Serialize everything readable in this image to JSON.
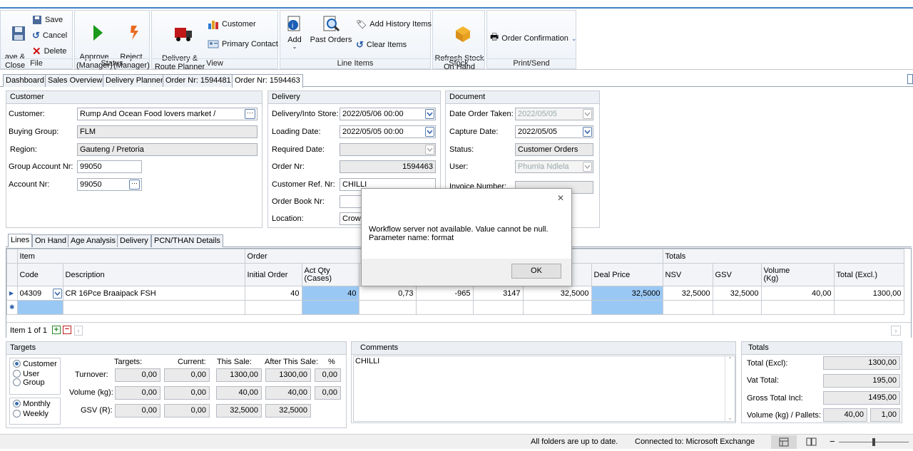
{
  "ribbon": {
    "file": {
      "title": "File",
      "save_close": "ave &\nClose",
      "save": "Save",
      "cancel": "Cancel",
      "delete": "Delete"
    },
    "status": {
      "title": "Status",
      "approve": "Approve\n(Manager)",
      "reject": "Reject\n(Manager)"
    },
    "view": {
      "title": "View",
      "delivery_planner": "Delivery &\nRoute Planner",
      "customer": "Customer",
      "primary_contact": "Primary Contact"
    },
    "line_items": {
      "title": "Line Items",
      "add": "Add",
      "past_orders": "Past Orders",
      "add_history": "Add History Items",
      "clear_items": "Clear Items"
    },
    "stock": {
      "title": "Stock",
      "refresh": "Refresh Stock\nOn Hand"
    },
    "print": {
      "title": "Print/Send",
      "order_confirmation": "Order Confirmation"
    }
  },
  "tabs": [
    "Dashboard",
    "Sales Overview",
    "Delivery Planner",
    "Order Nr: 1594481",
    "Order Nr: 1594463"
  ],
  "customer": {
    "title": "Customer",
    "customer_label": "Customer:",
    "customer_value": "Rump And Ocean Food lovers market /",
    "group_label": "Buying Group:",
    "group_value": "FLM",
    "region_label": "Region:",
    "region_value": "Gauteng / Pretoria",
    "group_acc_label": "Group Account Nr:",
    "group_acc_value": "99050",
    "acc_label": "Account Nr:",
    "acc_value": "99050"
  },
  "delivery": {
    "title": "Delivery",
    "into_store_label": "Delivery/Into Store:",
    "into_store_value": "2022/05/06 00:00",
    "loading_label": "Loading Date:",
    "loading_value": "2022/05/05 00:00",
    "required_label": "Required Date:",
    "required_value": "",
    "order_nr_label": "Order Nr:",
    "order_nr_value": "1594463",
    "cust_ref_label": "Customer Ref. Nr:",
    "cust_ref_value": "CHILLI",
    "order_book_label": "Order Book Nr:",
    "order_book_value": "",
    "location_label": "Location:",
    "location_value": "Crown"
  },
  "document": {
    "title": "Document",
    "date_taken_label": "Date Order Taken:",
    "date_taken_value": "2022/05/05",
    "capture_label": "Capture Date:",
    "capture_value": "2022/05/05",
    "status_label": "Status:",
    "status_value": "Customer Orders",
    "user_label": "User:",
    "user_value": "Phumla Ndlela",
    "invoice_label": "Invoice Number:"
  },
  "lower_tabs": [
    "Lines",
    "On Hand",
    "Age Analysis",
    "Delivery",
    "PCN/THAN Details"
  ],
  "grid": {
    "group_item": "Item",
    "group_order": "Order",
    "group_totals": "Totals",
    "headers": [
      "Code",
      "Description",
      "Initial Order",
      "Act Qty\n(Cases)",
      "",
      "",
      "",
      "Price",
      "Deal Price",
      "NSV",
      "GSV",
      "Volume\n(Kg)",
      "Total (Excl.)"
    ],
    "row": [
      "04309",
      "CR 16Pce Braaipack FSH",
      "40",
      "40",
      "0,73",
      "-965",
      "3147",
      "32,5000",
      "32,5000",
      "32,5000",
      "32,5000",
      "40,00",
      "1300,00"
    ],
    "footer": "Item 1 of 1"
  },
  "targets": {
    "title": "Targets",
    "radio_customer": "Customer",
    "radio_user": "User",
    "radio_group": "Group",
    "radio_monthly": "Monthly",
    "radio_weekly": "Weekly",
    "h_targets": "Targets:",
    "h_current": "Current:",
    "h_this_sale": "This Sale:",
    "h_after": "After This Sale:",
    "h_pct": "%",
    "rows": [
      {
        "label": "Turnover:",
        "targets": "0,00",
        "current": "0,00",
        "this_sale": "1300,00",
        "after": "1300,00",
        "pct": "0,00"
      },
      {
        "label": "Volume (kg):",
        "targets": "0,00",
        "current": "0,00",
        "this_sale": "40,00",
        "after": "40,00",
        "pct": "0,00"
      },
      {
        "label": "GSV (R):",
        "targets": "0,00",
        "current": "0,00",
        "this_sale": "32,5000",
        "after": "32,5000",
        "pct": ""
      }
    ]
  },
  "comments": {
    "title": "Comments",
    "text": "CHILLI"
  },
  "totals": {
    "title": "Totals",
    "excl_label": "Total (Excl):",
    "excl_value": "1300,00",
    "vat_label": "Vat Total:",
    "vat_value": "195,00",
    "gross_label": "Gross Total Incl:",
    "gross_value": "1495,00",
    "vol_label": "Volume (kg) / Pallets:",
    "vol_value": "40,00",
    "pallets_value": "1,00"
  },
  "dialog": {
    "message_line1": "Workflow server not available. Value cannot be null.",
    "message_line2": "Parameter name: format",
    "ok": "OK",
    "close": "✕"
  },
  "statusbar": {
    "folders": "All folders are up to date.",
    "connected": "Connected to: Microsoft Exchange"
  }
}
